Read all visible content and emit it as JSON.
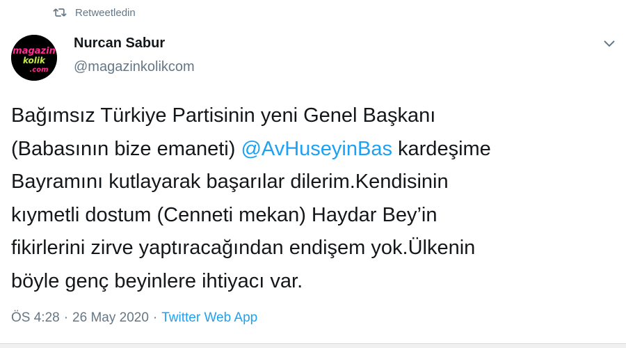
{
  "retweet": {
    "label": "Retweetledin",
    "icon": "retweet-icon"
  },
  "author": {
    "display_name": "Nurcan Sabur",
    "handle": "@magazinkolikcom",
    "avatar_text": "magazin kolik .com"
  },
  "menu": {
    "icon": "chevron-down-icon"
  },
  "tweet": {
    "text_part1": "Bağımsız Türkiye Partisinin yeni Genel Başkanı\n(Babasının bize emaneti) ",
    "mention": "@AvHuseyinBas",
    "text_part2": " kardeşime\nBayramını kutlayarak başarılar dilerim.Kendisinin\nkıymetli dostum (Cenneti mekan) Haydar Bey’in\nfikirlerini zirve yaptıracağından endişem yok.Ülkenin\nböyle genç beyinlere ihtiyacı var."
  },
  "meta": {
    "time": "ÖS 4:28",
    "separator": "·",
    "date": "26 May 2020",
    "source": "Twitter Web App"
  },
  "colors": {
    "link": "#1da1f2",
    "muted": "#657786",
    "text": "#14171a"
  }
}
